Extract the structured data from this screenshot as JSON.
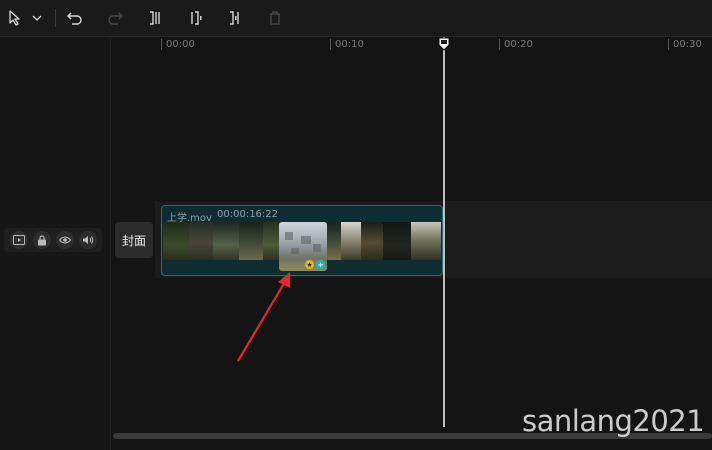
{
  "toolbar": {
    "select_tool": "select-pointer-icon",
    "select_dropdown": "chevron-down-icon",
    "undo": "undo-icon",
    "redo": "redo-icon",
    "split": "split-icon",
    "trim_left": "trim-left-icon",
    "trim_right": "trim-right-icon",
    "delete": "delete-icon"
  },
  "ruler": {
    "ticks": [
      "00:00",
      "00:10",
      "00:20",
      "00:30"
    ]
  },
  "track": {
    "controls": [
      "video-track-icon",
      "lock-icon",
      "eye-icon",
      "volume-icon"
    ],
    "cover_label": "封面"
  },
  "clip": {
    "name": "上学.mov",
    "duration": "00:00:16:22"
  },
  "watermark": "sanlang2021",
  "colors": {
    "clip_bg": "#0d2d30",
    "clip_border": "#2e6d71",
    "arrow": "#e8262b",
    "badge_add": "#1fb5c0",
    "badge_star": "#e9b824"
  }
}
